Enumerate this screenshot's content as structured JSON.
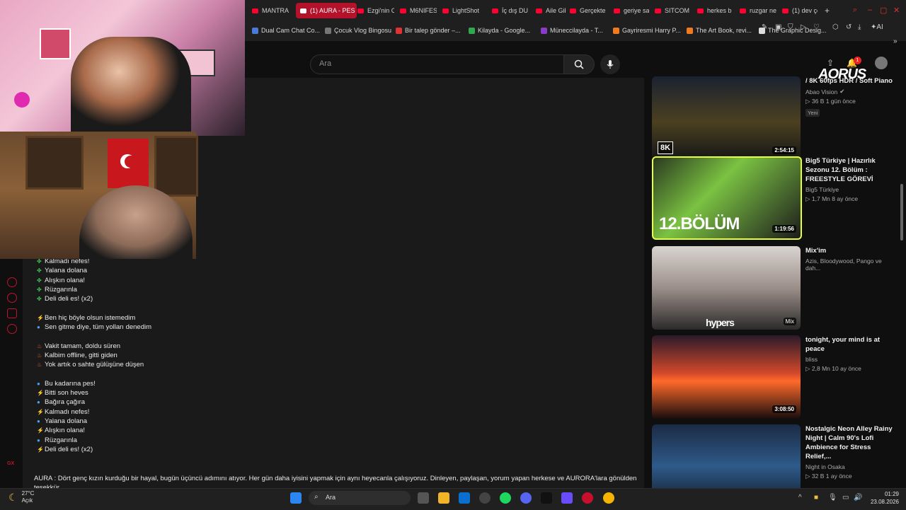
{
  "tabs": [
    {
      "label": "MANTRA",
      "active": false
    },
    {
      "label": "(1) AURA - PES (",
      "active": true
    },
    {
      "label": "Ezgi'nin C",
      "active": false
    },
    {
      "label": "M6NIFES",
      "active": false
    },
    {
      "label": "LightShot",
      "active": false
    },
    {
      "label": "İç dış DU",
      "active": false
    },
    {
      "label": "Aile Gibi I",
      "active": false
    },
    {
      "label": "Gerçekte",
      "active": false
    },
    {
      "label": "geriye sa",
      "active": false
    },
    {
      "label": "SITCOM",
      "active": false
    },
    {
      "label": "herkes b",
      "active": false
    },
    {
      "label": "ruzgar ne",
      "active": false
    },
    {
      "label": "(1) dev ço",
      "active": false
    }
  ],
  "new_tab": "+",
  "bookmarks": [
    "Dual Cam Chat Co...",
    "Çocuk Vlog Bingosu",
    "Bir talep gönder –...",
    "Kilayda - Google...",
    "Müneccilayda - T...",
    "Gayriresmi Harry P...",
    "The Art Book, revi...",
    "The Graphic Desig..."
  ],
  "toolbar_ai": "AI",
  "search": {
    "placeholder": "Ara"
  },
  "notifications_count": "1",
  "aorus_logo": "AORUS",
  "lyrics": [
    {
      "icon": "clover",
      "text": "Kalmadı nefes!"
    },
    {
      "icon": "clover",
      "text": "Yalana dolana"
    },
    {
      "icon": "clover",
      "text": "Alışkın olana!"
    },
    {
      "icon": "clover",
      "text": "Rüzgarınla"
    },
    {
      "icon": "clover",
      "text": "Deli deli es! (x2)"
    },
    {
      "icon": "",
      "text": ""
    },
    {
      "icon": "bolt",
      "text": "Ben hiç böyle olsun istemedim"
    },
    {
      "icon": "drop",
      "text": "Sen gitme diye, tüm yolları denedim"
    },
    {
      "icon": "",
      "text": ""
    },
    {
      "icon": "fire",
      "text": "Vakit tamam, doldu süren"
    },
    {
      "icon": "fire",
      "text": "Kalbim offline, gitti giden"
    },
    {
      "icon": "fire",
      "text": "Yok artık o sahte gülüşüne düşen"
    },
    {
      "icon": "",
      "text": ""
    },
    {
      "icon": "drop",
      "text": "Bu kadarına pes!"
    },
    {
      "icon": "bolt",
      "text": "Bitti son heves"
    },
    {
      "icon": "drop",
      "text": "Bağıra çağıra"
    },
    {
      "icon": "bolt",
      "text": "Kalmadı nefes!"
    },
    {
      "icon": "drop",
      "text": "Yalana dolana"
    },
    {
      "icon": "bolt",
      "text": "Alışkın olana!"
    },
    {
      "icon": "drop",
      "text": "Rüzgarınla"
    },
    {
      "icon": "bolt",
      "text": "Deli deli es! (x2)"
    }
  ],
  "description": "AURA : Dört genç kızın kurduğu bir hayal, bugün üçüncü adımını atıyor. Her gün daha iyisini yapmak için aynı heyecanla çalışıyoruz. Dinleyen, paylaşan, yorum yapan herkese ve AURORA'lara gönülden teşekkür",
  "left_rail_label": "GX",
  "recommendations": [
    {
      "title": "/ 8K 60fps HDR / Soft Piano",
      "channel": "Abao Vision",
      "verified": true,
      "views": "36 B",
      "age": "1 gün önce",
      "tag": "Yeni",
      "duration": "2:54:15",
      "badge": "8K",
      "overlay": ""
    },
    {
      "title": "Big5 Türkiye | Hazırlık Sezonu 12. Bölüm : FREESTYLE GÖREVİ",
      "channel": "Big5 Türkiye",
      "verified": false,
      "views": "1,7 Mn",
      "age": "8 ay önce",
      "tag": "",
      "duration": "1:19:56",
      "badge": "",
      "overlay": "12.BÖLÜM"
    },
    {
      "title": "Mix'im",
      "channel": "Azis, Bloodywood, Pango ve dah...",
      "verified": false,
      "views": "",
      "age": "",
      "tag": "",
      "duration": "Mix",
      "badge": "",
      "overlay": "hypers"
    },
    {
      "title": "tonight, your mind is at peace",
      "channel": "bliss",
      "verified": false,
      "views": "2,8 Mn",
      "age": "10 ay önce",
      "tag": "",
      "duration": "3:08:50",
      "badge": "",
      "overlay": ""
    },
    {
      "title": "Nostalgic Neon Alley Rainy Night | Calm 90's Lofi Ambience for Stress Relief,...",
      "channel": "Night in Osaka",
      "verified": false,
      "views": "32 B",
      "age": "1 ay önce",
      "tag": "",
      "duration": "",
      "badge": "",
      "overlay": ""
    }
  ],
  "taskbar": {
    "temperature": "27°C",
    "weather": "Açık",
    "search_label": "Ara",
    "time": "01:29",
    "date": "23.08.2026"
  }
}
